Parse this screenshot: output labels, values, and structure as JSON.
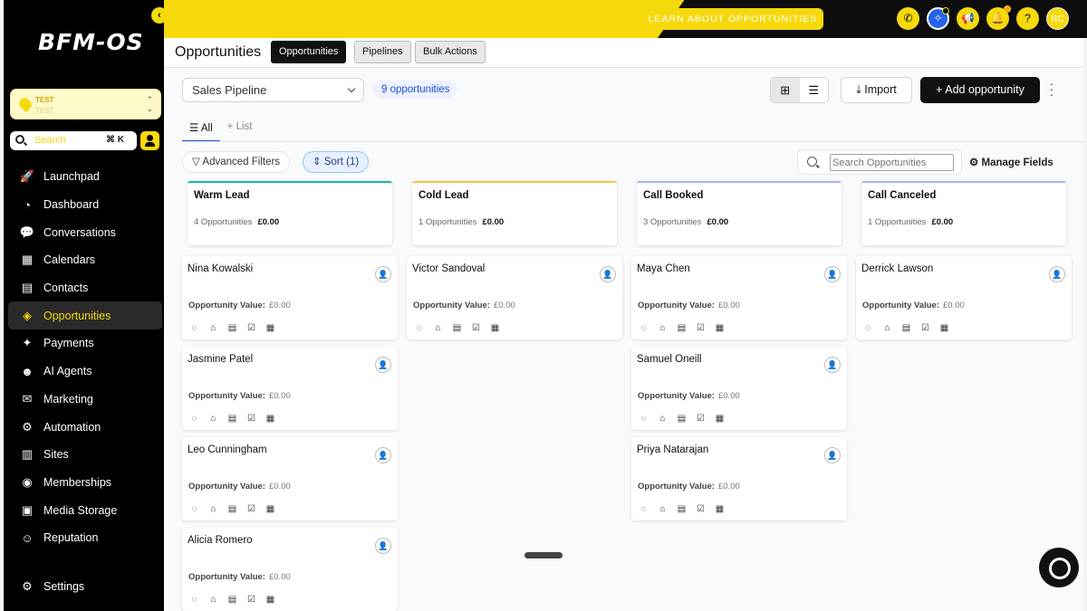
{
  "sidebar": {
    "collapse_icon": "chevron-left-icon",
    "logo": "BFM-OS",
    "account": {
      "name": "TEST",
      "sub": "TEST"
    },
    "search": {
      "placeholder": "Search",
      "shortcut": "⌘ K"
    },
    "items": [
      {
        "label": "Launchpad",
        "icon": "rocket-icon",
        "glyph": "🚀",
        "active": false
      },
      {
        "label": "Dashboard",
        "icon": "gauge-icon",
        "glyph": "◔",
        "active": false
      },
      {
        "label": "Conversations",
        "icon": "chat-icon",
        "glyph": "💬",
        "active": false
      },
      {
        "label": "Calendars",
        "icon": "calendar-icon",
        "glyph": "▦",
        "active": false
      },
      {
        "label": "Contacts",
        "icon": "contact-card-icon",
        "glyph": "▤",
        "active": false
      },
      {
        "label": "Opportunities",
        "icon": "opportunities-icon",
        "glyph": "◈",
        "active": true
      },
      {
        "label": "Payments",
        "icon": "payments-icon",
        "glyph": "✦",
        "active": false
      },
      {
        "label": "AI Agents",
        "icon": "ai-agent-icon",
        "glyph": "☻",
        "active": false
      },
      {
        "label": "Marketing",
        "icon": "marketing-icon",
        "glyph": "✉",
        "active": false
      },
      {
        "label": "Automation",
        "icon": "automation-icon",
        "glyph": "⚙",
        "active": false
      },
      {
        "label": "Sites",
        "icon": "sites-icon",
        "glyph": "▥",
        "active": false
      },
      {
        "label": "Memberships",
        "icon": "memberships-icon",
        "glyph": "◉",
        "active": false
      },
      {
        "label": "Media Storage",
        "icon": "media-icon",
        "glyph": "▣",
        "active": false
      },
      {
        "label": "Reputation",
        "icon": "reputation-icon",
        "glyph": "☺",
        "active": false
      }
    ],
    "settings": {
      "label": "Settings",
      "icon": "gear-icon",
      "glyph": "⚙"
    }
  },
  "topbar": {
    "learn_label": "LEARN ABOUT OPPORTUNITIES",
    "icons": [
      {
        "name": "phone-icon",
        "glyph": "✆"
      },
      {
        "name": "ai-sparkle-icon",
        "glyph": "✧"
      },
      {
        "name": "megaphone-icon",
        "glyph": "📢"
      },
      {
        "name": "bell-icon",
        "glyph": "🔔"
      },
      {
        "name": "help-icon",
        "glyph": "?"
      }
    ],
    "avatar_initials": "RC"
  },
  "subheader": {
    "title": "Opportunities",
    "tabs": [
      {
        "label": "Opportunities",
        "active": true
      },
      {
        "label": "Pipelines",
        "active": false
      },
      {
        "label": "Bulk Actions",
        "active": false
      }
    ]
  },
  "toolbar": {
    "pipeline": "Sales Pipeline",
    "count": "9 opportunities",
    "import_label": "Import",
    "add_label": "Add opportunity",
    "view_tabs": [
      "All",
      "List"
    ],
    "advanced_filters": "Advanced Filters",
    "sort": "Sort (1)",
    "search_placeholder": "Search Opportunities",
    "manage_fields": "Manage Fields"
  },
  "board": {
    "value_label": "Opportunity Value:",
    "columns": [
      {
        "title": "Warm Lead",
        "count": "4 Opportunities",
        "total": "£0.00",
        "color": "#14b8a6",
        "cards": [
          {
            "name": "Nina Kowalski",
            "value": "£0.00"
          },
          {
            "name": "Jasmine Patel",
            "value": "£0.00"
          },
          {
            "name": "Leo Cunningham",
            "value": "£0.00"
          },
          {
            "name": "Alicia Romero",
            "value": "£0.00"
          }
        ]
      },
      {
        "title": "Cold Lead",
        "count": "1 Opportunities",
        "total": "£0.00",
        "color": "#f5c542",
        "cards": [
          {
            "name": "Victor Sandoval",
            "value": "£0.00"
          }
        ]
      },
      {
        "title": "Call Booked",
        "count": "3 Opportunities",
        "total": "£0.00",
        "color": "#a5b4fc",
        "cards": [
          {
            "name": "Maya Chen",
            "value": "£0.00"
          },
          {
            "name": "Samuel Oneill",
            "value": "£0.00"
          },
          {
            "name": "Priya Natarajan",
            "value": "£0.00"
          }
        ]
      },
      {
        "title": "Call Canceled",
        "count": "1 Opportunities",
        "total": "£0.00",
        "color": "#a5b4fc",
        "cards": [
          {
            "name": "Derrick Lawson",
            "value": "£0.00"
          }
        ]
      }
    ]
  },
  "card_icons": [
    {
      "name": "comment-icon",
      "glyph": "◌"
    },
    {
      "name": "tag-icon",
      "glyph": "⌂"
    },
    {
      "name": "note-icon",
      "glyph": "▤"
    },
    {
      "name": "task-checkbox-icon",
      "glyph": "☑"
    },
    {
      "name": "appointment-icon",
      "glyph": "▦"
    }
  ]
}
